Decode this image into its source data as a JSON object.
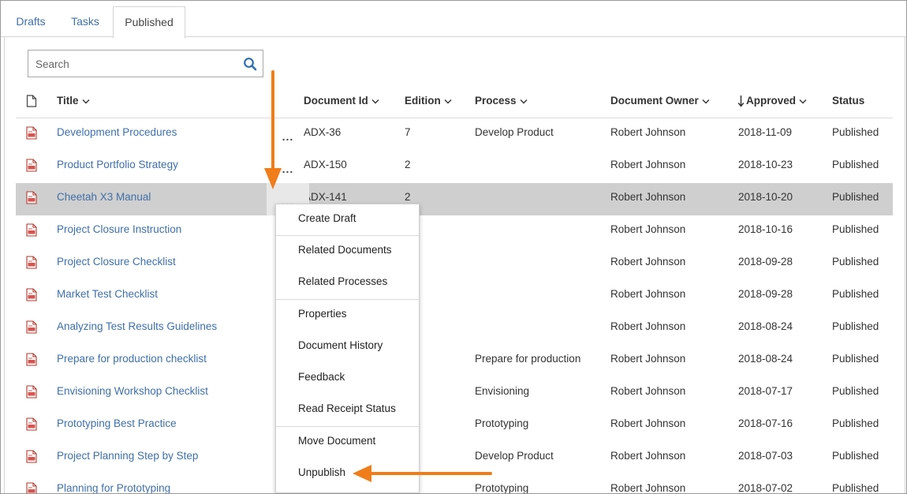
{
  "tabs": [
    {
      "label": "Drafts"
    },
    {
      "label": "Tasks"
    },
    {
      "label": "Published",
      "active": true
    }
  ],
  "search": {
    "placeholder": "Search",
    "icon": "search-icon"
  },
  "columns": {
    "title": "Title",
    "document_id": "Document Id",
    "edition": "Edition",
    "process": "Process",
    "owner": "Document Owner",
    "approved": "Approved",
    "status": "Status"
  },
  "rows": [
    {
      "title": "Development Procedures",
      "id": "ADX-36",
      "edition": "7",
      "process": "Develop Product",
      "owner": "Robert Johnson",
      "approved": "2018-11-09",
      "status": "Published"
    },
    {
      "title": "Product Portfolio Strategy",
      "id": "ADX-150",
      "edition": "2",
      "process": "",
      "owner": "Robert Johnson",
      "approved": "2018-10-23",
      "status": "Published"
    },
    {
      "title": "Cheetah X3 Manual",
      "id": "ADX-141",
      "edition": "2",
      "process": "",
      "owner": "Robert Johnson",
      "approved": "2018-10-20",
      "status": "Published",
      "selected": true
    },
    {
      "title": "Project Closure Instruction",
      "id": "",
      "edition": "",
      "process": "",
      "owner": "Robert Johnson",
      "approved": "2018-10-16",
      "status": "Published"
    },
    {
      "title": "Project Closure Checklist",
      "id": "",
      "edition": "",
      "process": "",
      "owner": "Robert Johnson",
      "approved": "2018-09-28",
      "status": "Published"
    },
    {
      "title": "Market Test Checklist",
      "id": "",
      "edition": "",
      "process": "",
      "owner": "Robert Johnson",
      "approved": "2018-09-28",
      "status": "Published"
    },
    {
      "title": "Analyzing Test Results Guidelines",
      "id": "",
      "edition": "",
      "process": "",
      "owner": "Robert Johnson",
      "approved": "2018-08-24",
      "status": "Published"
    },
    {
      "title": "Prepare for production checklist",
      "id": "",
      "edition": "",
      "process": "Prepare for production",
      "owner": "Robert Johnson",
      "approved": "2018-08-24",
      "status": "Published"
    },
    {
      "title": "Envisioning Workshop Checklist",
      "id": "",
      "edition": "",
      "process": "Envisioning",
      "owner": "Robert Johnson",
      "approved": "2018-07-17",
      "status": "Published"
    },
    {
      "title": "Prototyping Best Practice",
      "id": "",
      "edition": "",
      "process": "Prototyping",
      "owner": "Robert Johnson",
      "approved": "2018-07-16",
      "status": "Published"
    },
    {
      "title": "Project Planning Step by Step",
      "id": "",
      "edition": "",
      "process": "Develop Product",
      "owner": "Robert Johnson",
      "approved": "2018-07-03",
      "status": "Published"
    },
    {
      "title": "Planning for Prototyping",
      "id": "",
      "edition": "",
      "process": "Prototyping",
      "owner": "Robert Johnson",
      "approved": "2018-07-02",
      "status": "Published"
    }
  ],
  "row_action_label": "...",
  "context_menu": {
    "items": [
      "Create Draft",
      "Related Documents",
      "Related Processes",
      "Properties",
      "Document History",
      "Feedback",
      "Read Receipt Status",
      "Move Document",
      "Unpublish"
    ]
  },
  "colors": {
    "link": "#3f6fa8",
    "annotation_arrow": "#f07d1a",
    "selected_row": "#cfcfcf",
    "doc_icon": "#c0392b"
  }
}
